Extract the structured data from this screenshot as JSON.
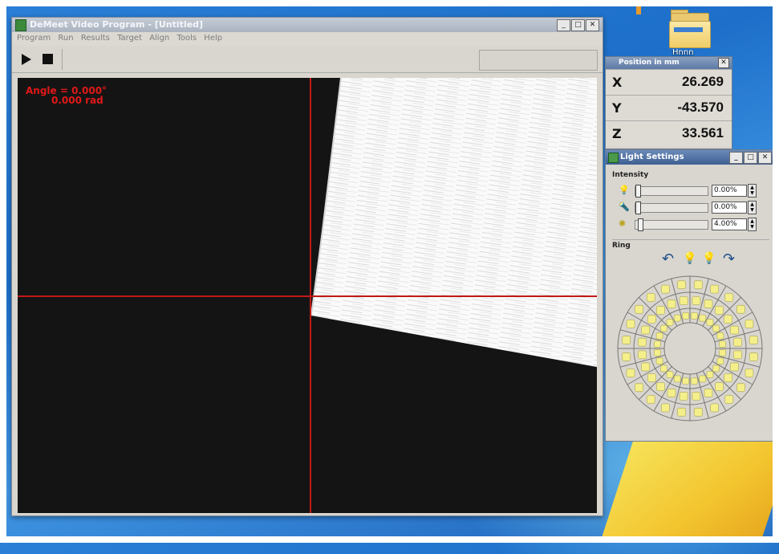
{
  "desktop": {
    "folder_label": "Hnnn",
    "colors": {
      "background": "#1d6fc9",
      "flag": "#f3c52f"
    }
  },
  "main_window": {
    "title": "DeMeet Video Program - [Untitled]",
    "menu": [
      "Program",
      "Run",
      "Results",
      "Target",
      "Align",
      "Tools",
      "Help"
    ],
    "toolbar": {
      "play_icon": "play-icon",
      "stop_icon": "stop-icon"
    },
    "window_buttons": [
      "_",
      "□",
      "✕"
    ],
    "overlay": {
      "angle_deg": "Angle = 0.000°",
      "angle_rad": "0.000 rad"
    },
    "crosshair_color": "#c21818"
  },
  "position_window": {
    "title": "Position in mm",
    "close": "✕",
    "rows": [
      {
        "axis": "X",
        "value": "26.269"
      },
      {
        "axis": "Y",
        "value": "-43.570"
      },
      {
        "axis": "Z",
        "value": "33.561"
      }
    ]
  },
  "light_settings": {
    "title": "Light Settings",
    "window_buttons": [
      "_",
      "□",
      "✕"
    ],
    "intensity_label": "Intensity",
    "rows": [
      {
        "icon": "bulb-icon",
        "value": "0.00%",
        "level": 0.0
      },
      {
        "icon": "lamp-icon",
        "value": "0.00%",
        "level": 0.0
      },
      {
        "icon": "ring-light-icon",
        "value": "4.00%",
        "level": 0.04
      }
    ],
    "ring_label": "Ring",
    "led_color": "#f4ef8a"
  }
}
